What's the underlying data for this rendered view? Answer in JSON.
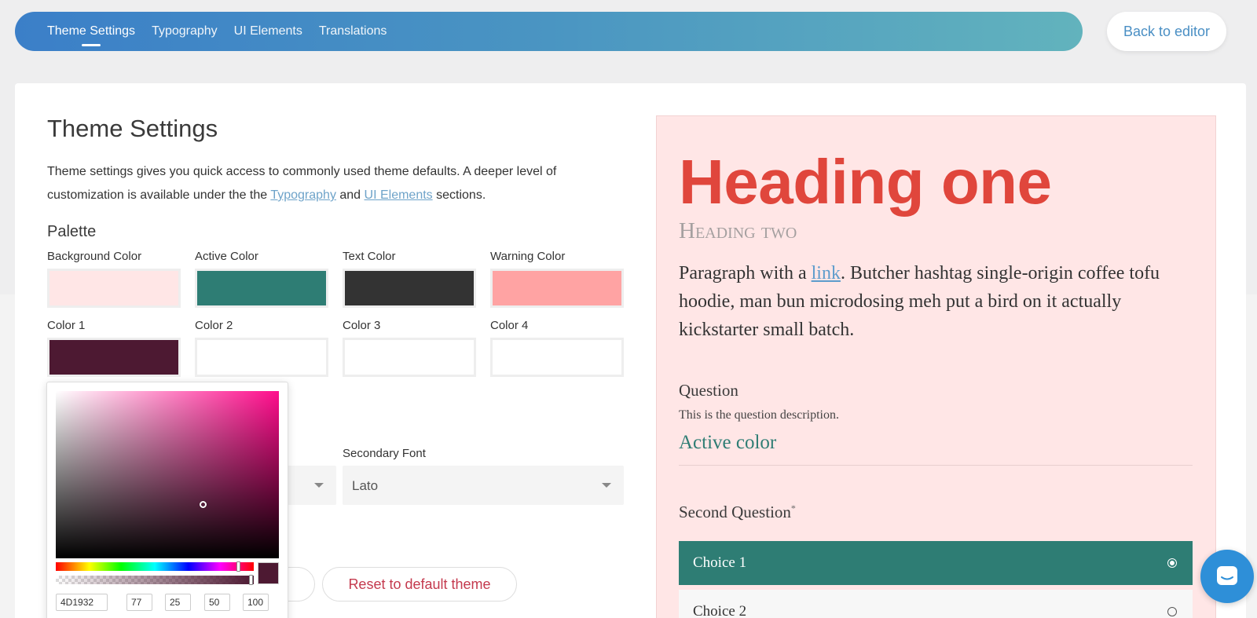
{
  "nav": {
    "tabs": [
      {
        "label": "Theme Settings",
        "active": true
      },
      {
        "label": "Typography",
        "active": false
      },
      {
        "label": "UI Elements",
        "active": false
      },
      {
        "label": "Translations",
        "active": false
      }
    ],
    "back_label": "Back to editor"
  },
  "settings": {
    "title": "Theme Settings",
    "intro_before": "Theme settings gives you quick access to commonly used theme defaults. A deeper level of customization is available under the the ",
    "intro_link1": "Typography",
    "intro_and": " and ",
    "intro_link2": "UI Elements",
    "intro_after": " sections.",
    "palette_label": "Palette",
    "swatches": [
      {
        "label": "Background Color",
        "color": "#ffe6e6"
      },
      {
        "label": "Active Color",
        "color": "#2e7d74"
      },
      {
        "label": "Text Color",
        "color": "#333333"
      },
      {
        "label": "Warning Color",
        "color": "#ffa3a3"
      },
      {
        "label": "Color 1",
        "color": "#4d1932"
      },
      {
        "label": "Color 2",
        "color": ""
      },
      {
        "label": "Color 3",
        "color": ""
      },
      {
        "label": "Color 4",
        "color": ""
      }
    ],
    "secondary_font_label": "Secondary Font",
    "secondary_font_value": "Lato",
    "reset_label": "Reset to default theme"
  },
  "picker": {
    "hex": "4D1932",
    "r": "77",
    "g": "25",
    "b": "50",
    "a": "100",
    "current_color": "#4d1932"
  },
  "preview": {
    "heading_one": "Heading one",
    "heading_two": "Heading two",
    "para_before": "Paragraph with a ",
    "para_link": "link",
    "para_after": ". Butcher hashtag single-origin coffee tofu hoodie, man bun microdosing meh put a bird on it actually kickstarter small batch.",
    "question_title": "Question",
    "question_desc": "This is the question description.",
    "active_color_label": "Active color",
    "second_question": "Second Question",
    "required_mark": "*",
    "choices": [
      {
        "label": "Choice 1",
        "selected": true
      },
      {
        "label": "Choice 2",
        "selected": false
      }
    ]
  },
  "colors": {
    "accent": "#2e7d74",
    "heading": "#e0463c",
    "link": "#5d9ccc"
  }
}
